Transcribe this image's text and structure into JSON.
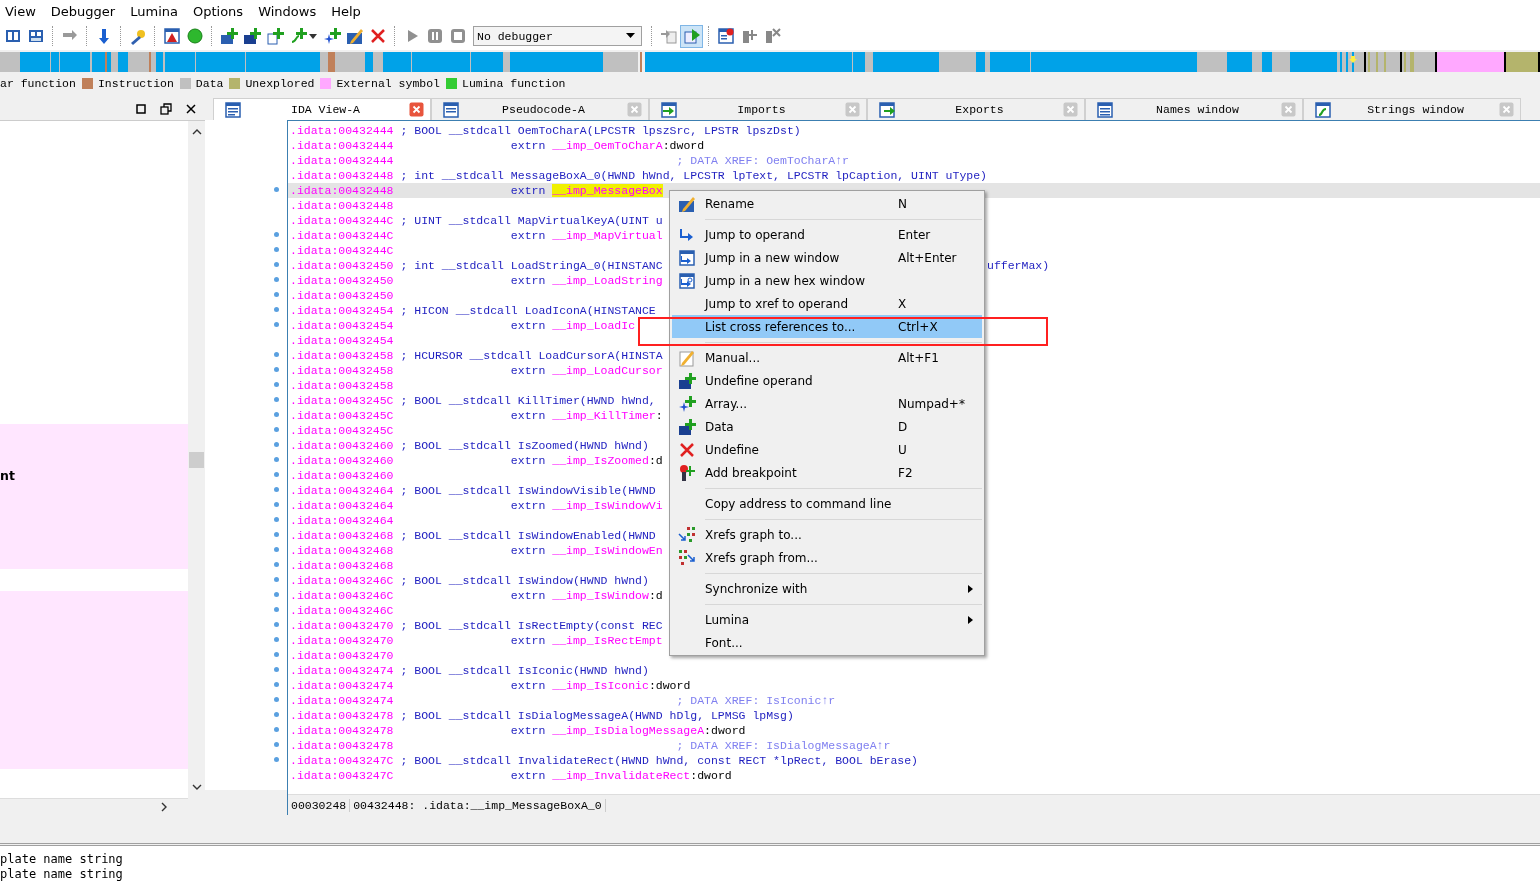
{
  "menu_bar": [
    "View",
    "Debugger",
    "Lumina",
    "Options",
    "Windows",
    "Help"
  ],
  "toolbar": {
    "tools": [
      {
        "selected": false
      },
      {
        "selected": false
      },
      {
        "selected": false
      },
      {
        "selected": false
      },
      {
        "selected": false
      },
      {
        "selected": false
      },
      {
        "selected": false
      },
      {
        "selected": false
      },
      {
        "selected": false
      },
      {
        "selected": false
      },
      {
        "selected": false
      },
      {
        "selected": false
      },
      {
        "selected": false
      },
      {
        "selected": false
      },
      {
        "selected": false
      },
      {
        "selected": false
      },
      {
        "selected": false
      },
      {
        "selected": false
      },
      {
        "selected": true
      },
      {
        "selected": false
      },
      {
        "selected": false
      },
      {
        "selected": false
      }
    ],
    "debugger": "No debugger"
  },
  "legend": [
    {
      "label": "ar function"
    },
    {
      "label": "Instruction",
      "color": "#c0805a"
    },
    {
      "label": "Data",
      "color": "#c0c0c0"
    },
    {
      "label": "Unexplored",
      "color": "#b4b46c"
    },
    {
      "label": "External symbol",
      "color": "#ffa8ff"
    },
    {
      "label": "Lumina function",
      "color": "#33cc33"
    }
  ],
  "left_pane": {
    "text": "nt"
  },
  "tabs": [
    {
      "label": "IDA View-A",
      "selected": true
    },
    {
      "label": "Pseudocode-A",
      "selected": false
    },
    {
      "label": "Imports",
      "selected": false
    },
    {
      "label": "Exports",
      "selected": false
    },
    {
      "label": "Names window",
      "selected": false
    },
    {
      "label": "Strings window",
      "selected": false
    }
  ],
  "code_lines": [
    {
      "address": ".idata:00432444",
      "kind": "decl",
      "text": "; BOOL __stdcall OemToCharA(LPCSTR lpszSrc, LPSTR lpszDst)",
      "selected": false,
      "marker": false
    },
    {
      "address": ".idata:00432444",
      "kind": "extrn",
      "keyword": "extrn",
      "symbol": "__imp_OemToCharA",
      "suffix": ":dword",
      "highlighted": false,
      "selected": false,
      "marker": false
    },
    {
      "address": ".idata:00432444",
      "kind": "comment",
      "text": "; DATA XREF: OemToCharA↑r",
      "selected": false,
      "marker": false
    },
    {
      "address": ".idata:00432448",
      "kind": "decl",
      "text": "; int __stdcall MessageBoxA_0(HWND hWnd, LPCSTR lpText, LPCSTR lpCaption, UINT uType)",
      "selected": false,
      "marker": false
    },
    {
      "address": ".idata:00432448",
      "kind": "extrn",
      "keyword": "extrn",
      "symbol": "__imp_MessageBox",
      "highlighted": true,
      "selected": true,
      "marker": true
    },
    {
      "address": ".idata:00432448",
      "kind": "blank",
      "selected": false,
      "marker": false
    },
    {
      "address": ".idata:0043244C",
      "kind": "decl",
      "text": "; UINT __stdcall MapVirtualKeyA(UINT u",
      "selected": false,
      "marker": false
    },
    {
      "address": ".idata:0043244C",
      "kind": "extrn",
      "keyword": "extrn",
      "symbol": "__imp_MapVirtual",
      "highlighted": false,
      "selected": false,
      "marker": true
    },
    {
      "address": ".idata:0043244C",
      "kind": "blank",
      "selected": false,
      "marker": true
    },
    {
      "address": ".idata:00432450",
      "kind": "decl",
      "text": "; int __stdcall LoadStringA_0(HINSTANC",
      "tail": "ufferMax)",
      "selected": false,
      "marker": true
    },
    {
      "address": ".idata:00432450",
      "kind": "extrn",
      "keyword": "extrn",
      "symbol": "__imp_LoadString",
      "highlighted": false,
      "selected": false,
      "marker": true
    },
    {
      "address": ".idata:00432450",
      "kind": "blank",
      "selected": false,
      "marker": true
    },
    {
      "address": ".idata:00432454",
      "kind": "decl",
      "text": "; HICON __stdcall LoadIconA(HINSTANCE",
      "selected": false,
      "marker": true
    },
    {
      "address": ".idata:00432454",
      "kind": "extrn",
      "keyword": "extrn",
      "symbol": "__imp_LoadIc",
      "highlighted": false,
      "selected": false,
      "marker": true
    },
    {
      "address": ".idata:00432454",
      "kind": "blank",
      "selected": false,
      "marker": false
    },
    {
      "address": ".idata:00432458",
      "kind": "decl",
      "text": "; HCURSOR __stdcall LoadCursorA(HINSTA",
      "selected": false,
      "marker": true
    },
    {
      "address": ".idata:00432458",
      "kind": "extrn",
      "keyword": "extrn",
      "symbol": "__imp_LoadCursor",
      "highlighted": false,
      "selected": false,
      "marker": true
    },
    {
      "address": ".idata:00432458",
      "kind": "blank",
      "selected": false,
      "marker": true
    },
    {
      "address": ".idata:0043245C",
      "kind": "decl",
      "text": "; BOOL __stdcall KillTimer(HWND hWnd,",
      "selected": false,
      "marker": true
    },
    {
      "address": ".idata:0043245C",
      "kind": "extrn",
      "keyword": "extrn",
      "symbol": "__imp_KillTimer",
      "suffix": ":",
      "highlighted": false,
      "selected": false,
      "marker": true
    },
    {
      "address": ".idata:0043245C",
      "kind": "blank",
      "selected": false,
      "marker": true
    },
    {
      "address": ".idata:00432460",
      "kind": "decl",
      "text": "; BOOL __stdcall IsZoomed(HWND hWnd)",
      "selected": false,
      "marker": true
    },
    {
      "address": ".idata:00432460",
      "kind": "extrn",
      "keyword": "extrn",
      "symbol": "__imp_IsZoomed",
      "suffix": ":d",
      "highlighted": false,
      "selected": false,
      "marker": true
    },
    {
      "address": ".idata:00432460",
      "kind": "blank",
      "selected": false,
      "marker": true
    },
    {
      "address": ".idata:00432464",
      "kind": "decl",
      "text": "; BOOL __stdcall IsWindowVisible(HWND",
      "selected": false,
      "marker": true
    },
    {
      "address": ".idata:00432464",
      "kind": "extrn",
      "keyword": "extrn",
      "symbol": "__imp_IsWindowVi",
      "highlighted": false,
      "selected": false,
      "marker": true
    },
    {
      "address": ".idata:00432464",
      "kind": "blank",
      "selected": false,
      "marker": true
    },
    {
      "address": ".idata:00432468",
      "kind": "decl",
      "text": "; BOOL __stdcall IsWindowEnabled(HWND",
      "selected": false,
      "marker": true
    },
    {
      "address": ".idata:00432468",
      "kind": "extrn",
      "keyword": "extrn",
      "symbol": "__imp_IsWindowEn",
      "highlighted": false,
      "selected": false,
      "marker": true
    },
    {
      "address": ".idata:00432468",
      "kind": "blank",
      "selected": false,
      "marker": true
    },
    {
      "address": ".idata:0043246C",
      "kind": "decl",
      "text": "; BOOL __stdcall IsWindow(HWND hWnd)",
      "selected": false,
      "marker": true
    },
    {
      "address": ".idata:0043246C",
      "kind": "extrn",
      "keyword": "extrn",
      "symbol": "__imp_IsWindow",
      "suffix": ":d",
      "highlighted": false,
      "selected": false,
      "marker": true
    },
    {
      "address": ".idata:0043246C",
      "kind": "blank",
      "selected": false,
      "marker": true
    },
    {
      "address": ".idata:00432470",
      "kind": "decl",
      "text": "; BOOL __stdcall IsRectEmpty(const REC",
      "selected": false,
      "marker": true
    },
    {
      "address": ".idata:00432470",
      "kind": "extrn",
      "keyword": "extrn",
      "symbol": "__imp_IsRectEmpt",
      "highlighted": false,
      "selected": false,
      "marker": true
    },
    {
      "address": ".idata:00432470",
      "kind": "blank",
      "selected": false,
      "marker": true
    },
    {
      "address": ".idata:00432474",
      "kind": "decl",
      "text": "; BOOL __stdcall IsIconic(HWND hWnd)",
      "selected": false,
      "marker": true
    },
    {
      "address": ".idata:00432474",
      "kind": "extrn",
      "keyword": "extrn",
      "symbol": "__imp_IsIconic",
      "suffix": ":dword",
      "highlighted": false,
      "selected": false,
      "marker": true
    },
    {
      "address": ".idata:00432474",
      "kind": "comment",
      "text": "; DATA XREF: IsIconic↑r",
      "selected": false,
      "marker": true
    },
    {
      "address": ".idata:00432478",
      "kind": "decl",
      "text": "; BOOL __stdcall IsDialogMessageA(HWND hDlg, LPMSG lpMsg)",
      "selected": false,
      "marker": true
    },
    {
      "address": ".idata:00432478",
      "kind": "extrn",
      "keyword": "extrn",
      "symbol": "__imp_IsDialogMessageA",
      "suffix": ":dword",
      "highlighted": false,
      "selected": false,
      "marker": true
    },
    {
      "address": ".idata:00432478",
      "kind": "comment",
      "text": "; DATA XREF: IsDialogMessageA↑r",
      "selected": false,
      "marker": true
    },
    {
      "address": ".idata:0043247C",
      "kind": "decl",
      "text": "; BOOL __stdcall InvalidateRect(HWND hWnd, const RECT *lpRect, BOOL bErase)",
      "selected": false,
      "marker": true
    },
    {
      "address": ".idata:0043247C",
      "kind": "extrn",
      "keyword": "extrn",
      "symbol": "__imp_InvalidateRect",
      "suffix": ":dword",
      "highlighted": false,
      "selected": false,
      "marker": false
    }
  ],
  "status_line": [
    "00030248",
    "00432448: .idata:__imp_MessageBoxA_0"
  ],
  "context_menu": [
    {
      "kind": "item",
      "label": "Rename",
      "shortcut": "N",
      "selected": false,
      "submenu": false
    },
    {
      "kind": "separator"
    },
    {
      "kind": "item",
      "label": "Jump to operand",
      "shortcut": "Enter",
      "selected": false,
      "submenu": false
    },
    {
      "kind": "item",
      "label": "Jump in a new window",
      "shortcut": "Alt+Enter",
      "selected": false,
      "submenu": false
    },
    {
      "kind": "item",
      "label": "Jump in a new hex window",
      "selected": false,
      "submenu": false
    },
    {
      "kind": "item",
      "label": "Jump to xref to operand",
      "shortcut": "X",
      "selected": false,
      "submenu": false
    },
    {
      "kind": "item",
      "label": "List cross references to...",
      "shortcut": "Ctrl+X",
      "selected": true,
      "submenu": false
    },
    {
      "kind": "separator"
    },
    {
      "kind": "item",
      "label": "Manual...",
      "shortcut": "Alt+F1",
      "selected": false,
      "submenu": false
    },
    {
      "kind": "item",
      "label": "Undefine operand",
      "selected": false,
      "submenu": false
    },
    {
      "kind": "item",
      "label": "Array...",
      "shortcut": "Numpad+*",
      "selected": false,
      "submenu": false
    },
    {
      "kind": "item",
      "label": "Data",
      "shortcut": "D",
      "selected": false,
      "submenu": false
    },
    {
      "kind": "item",
      "label": "Undefine",
      "shortcut": "U",
      "selected": false,
      "submenu": false
    },
    {
      "kind": "item",
      "label": "Add breakpoint",
      "shortcut": "F2",
      "selected": false,
      "submenu": false
    },
    {
      "kind": "separator"
    },
    {
      "kind": "item",
      "label": "Copy address to command line",
      "selected": false,
      "submenu": false
    },
    {
      "kind": "separator"
    },
    {
      "kind": "item",
      "label": "Xrefs graph to...",
      "selected": false,
      "submenu": false
    },
    {
      "kind": "item",
      "label": "Xrefs graph from...",
      "selected": false,
      "submenu": false
    },
    {
      "kind": "separator"
    },
    {
      "kind": "item",
      "label": "Synchronize with",
      "selected": false,
      "submenu": true
    },
    {
      "kind": "separator"
    },
    {
      "kind": "item",
      "label": "Lumina",
      "selected": false,
      "submenu": true
    },
    {
      "kind": "item",
      "label": "Font...",
      "selected": false,
      "submenu": false
    }
  ],
  "output_lines": [
    "plate name string",
    "plate name string"
  ]
}
